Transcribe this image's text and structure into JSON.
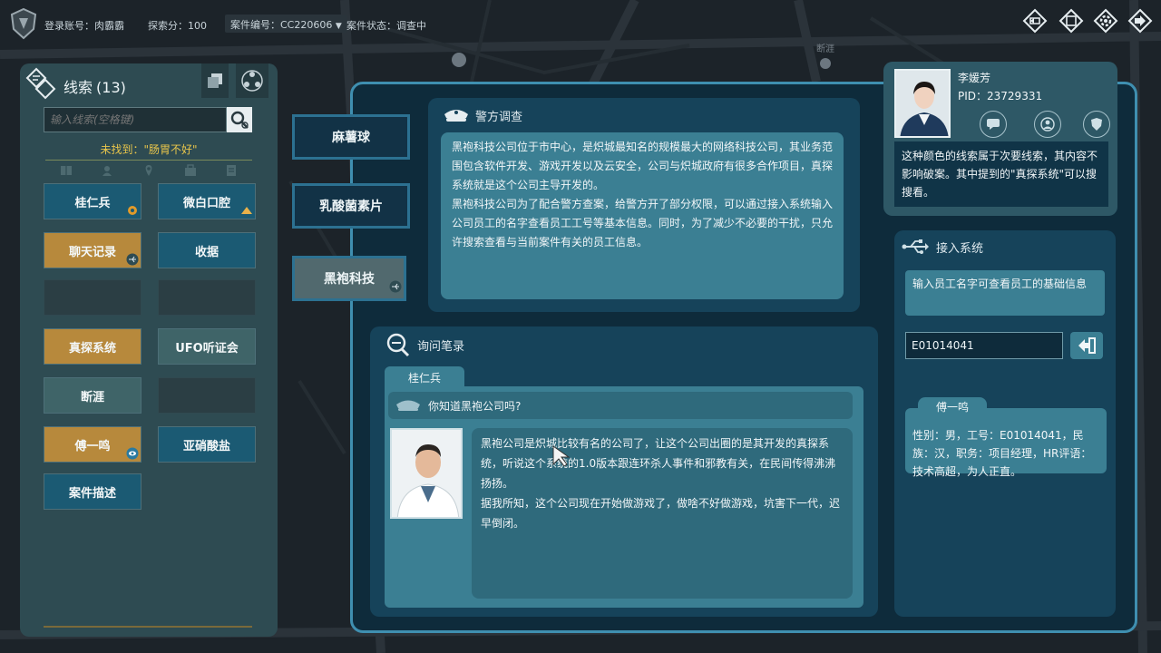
{
  "topbar": {
    "account_label": "登录账号：",
    "account_value": "肉霸霸",
    "score_label": "探索分：",
    "score_value": "100",
    "case_label": "案件编号：",
    "case_value": "CC220606",
    "status_label": "案件状态：",
    "status_value": "调查中",
    "icons": [
      "back-icon",
      "window-icon",
      "settings-icon",
      "exit-icon"
    ]
  },
  "clues_panel": {
    "title": "线索",
    "count": "(13)",
    "search_placeholder": "输入线索(空格键)",
    "not_found": "未找到：\"肠胃不好\"",
    "filters": [
      "book-icon",
      "person-icon",
      "location-icon",
      "case-icon",
      "document-icon"
    ],
    "items": [
      {
        "label": "桂仁兵",
        "style": "blue",
        "tag": "target"
      },
      {
        "label": "微白口腔",
        "style": "blue",
        "tag": "warning"
      },
      {
        "label": "聊天记录",
        "style": "orange",
        "tag": "usb"
      },
      {
        "label": "收据",
        "style": "blue",
        "tag": ""
      },
      {
        "label": "",
        "style": "empty",
        "tag": ""
      },
      {
        "label": "",
        "style": "empty",
        "tag": ""
      },
      {
        "label": "真探系统",
        "style": "orange",
        "tag": ""
      },
      {
        "label": "UFO听证会",
        "style": "grey",
        "tag": ""
      },
      {
        "label": "断涯",
        "style": "grey",
        "tag": ""
      },
      {
        "label": "",
        "style": "empty",
        "tag": ""
      },
      {
        "label": "傅一鸣",
        "style": "orange",
        "tag": "eye"
      },
      {
        "label": "亚硝酸盐",
        "style": "blue",
        "tag": ""
      },
      {
        "label": "案件描述",
        "style": "blue",
        "tag": ""
      }
    ]
  },
  "tabs": [
    {
      "label": "麻薯球"
    },
    {
      "label": "乳酸菌素片"
    },
    {
      "label": "黑袍科技"
    }
  ],
  "police": {
    "title": "警方调查",
    "paragraphs": [
      "黑袍科技公司位于市中心，是炽城最知名的规模最大的网络科技公司，其业务范围包含软件开发、游戏开发以及云安全，公司与炽城政府有很多合作项目，真探系统就是这个公司主导开发的。",
      "黑袍科技公司为了配合警方查案，给警方开了部分权限，可以通过接入系统输入公司员工的名字查看员工工号等基本信息。同时，为了减少不必要的干扰，只允许搜索查看与当前案件有关的员工信息。"
    ]
  },
  "inquiry": {
    "title": "询问笔录",
    "person": "桂仁兵",
    "question": "你知道黑袍公司吗?",
    "answer_paragraphs": [
      "黑袍公司是炽城比较有名的公司了，让这个公司出圈的是其开发的真探系统，听说这个系统的1.0版本跟连环杀人事件和邪教有关，在民间传得沸沸扬扬。",
      "据我所知，这个公司现在开始做游戏了，做啥不好做游戏，坑害下一代，迟早倒闭。"
    ]
  },
  "character": {
    "name": "李媛芳",
    "pid": "PID：23729331",
    "note": "这种颜色的线索属于次要线索，其内容不影响破案。其中提到的\"真探系统\"可以搜搜看。",
    "icons": [
      "chat-icon",
      "profile-icon",
      "badge-icon"
    ]
  },
  "access": {
    "title": "接入系统",
    "desc": "输入员工名字可查看员工的基础信息",
    "input_value": "E01014041",
    "result_name": "傅一鸣",
    "result_text": "性别：男，工号：E01014041，民族：汉，职务：项目经理，HR评语：技术高超，为人正直。"
  },
  "map": {
    "street_label": "断涯"
  },
  "colors": {
    "accent_blue": "#1b5a73",
    "accent_orange": "#b7893c",
    "frame_border": "#3f8fb0",
    "highlight_yellow": "#e8c54b"
  }
}
